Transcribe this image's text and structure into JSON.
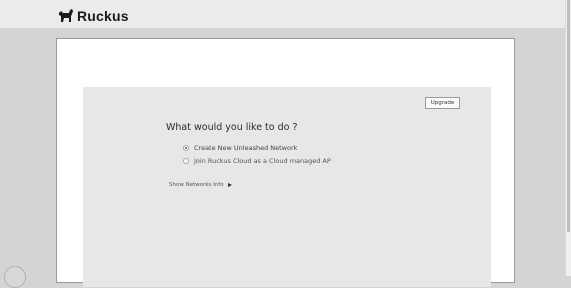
{
  "header": {
    "brand_name": "Ruckus",
    "logo_icon": "ruckus-dog-icon"
  },
  "panel": {
    "upgrade_label": "Upgrade",
    "prompt": "What would you like to do ?",
    "options": [
      {
        "label": "Create New Unleashed Network",
        "selected": true
      },
      {
        "label": "Join Ruckus Cloud as a Cloud managed AP",
        "selected": false
      }
    ],
    "show_networks_label": "Show Networks Info",
    "show_networks_icon": "triangle-right-icon"
  },
  "colors": {
    "header_bg": "#ebebeb",
    "page_bg": "#d4d4d4",
    "panel_bg": "#e7e7e7"
  }
}
